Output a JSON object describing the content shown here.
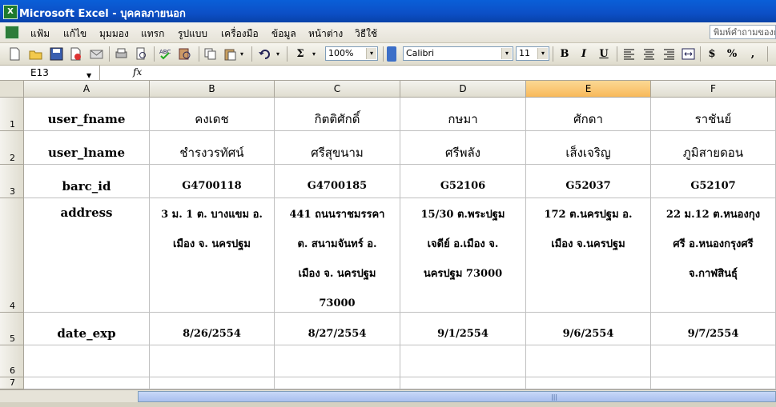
{
  "window": {
    "title": "Microsoft Excel - บุคคลภายนอก",
    "app_icon_label": "X"
  },
  "menu": {
    "items": [
      "แฟ้ม",
      "แก้ไข",
      "มุมมอง",
      "แทรก",
      "รูปแบบ",
      "เครื่องมือ",
      "ข้อมูล",
      "หน้าต่าง",
      "วิธีใช้"
    ],
    "help_placeholder": "พิมพ์คำถามของคุณ"
  },
  "toolbar": {
    "zoom": "100%",
    "font": "Calibri",
    "font_size": "11",
    "sigma": "Σ",
    "bold": "B",
    "italic": "I",
    "underline": "U",
    "currency": "$",
    "percent": "%",
    "comma": ","
  },
  "formula_bar": {
    "name_box": "E13",
    "fx": "fx",
    "content": ""
  },
  "sheet": {
    "columns": [
      "A",
      "B",
      "C",
      "D",
      "E",
      "F"
    ],
    "selected_column": "E",
    "row_numbers": [
      "1",
      "2",
      "3",
      "4",
      "5",
      "6",
      "7"
    ],
    "rows": [
      [
        "user_fname",
        "คงเดช",
        "กิตติศักดิ์",
        "กษมา",
        "ศักดา",
        "ราชันย์"
      ],
      [
        "user_lname",
        "ชำรงวรทัศน์",
        "ศรีสุขนาม",
        "ศรีพลัง",
        "เส็งเจริญ",
        "ภูมิสายดอน"
      ],
      [
        "barc_id",
        "G4700118",
        "G4700185",
        "G52106",
        "G52037",
        "G52107"
      ],
      [
        "address",
        [
          "3 ม. 1 ต. บางแขม อ.",
          "เมือง จ. นครปฐม"
        ],
        [
          "441 ถนนราชมรรคา",
          "ต. สนามจันทร์ อ.",
          "เมือง จ. นครปฐม",
          "73000"
        ],
        [
          "15/30 ต.พระปฐม",
          "เจดีย์ อ.เมือง จ.",
          "นครปฐม 73000"
        ],
        [
          "172 ต.นครปฐม อ.",
          "เมือง จ.นครปฐม"
        ],
        [
          "22 ม.12 ต.หนองกุง",
          "ศรี อ.หนองกรุงศรี",
          "จ.กาฬสินธุ์"
        ]
      ],
      [
        "date_exp",
        "8/26/2554",
        "8/27/2554",
        "9/1/2554",
        "9/6/2554",
        "9/7/2554"
      ],
      [
        "",
        "",
        "",
        "",
        "",
        ""
      ],
      [
        "",
        "",
        "",
        "",
        "",
        ""
      ]
    ]
  },
  "scrollbar": {
    "grip": "|||"
  }
}
